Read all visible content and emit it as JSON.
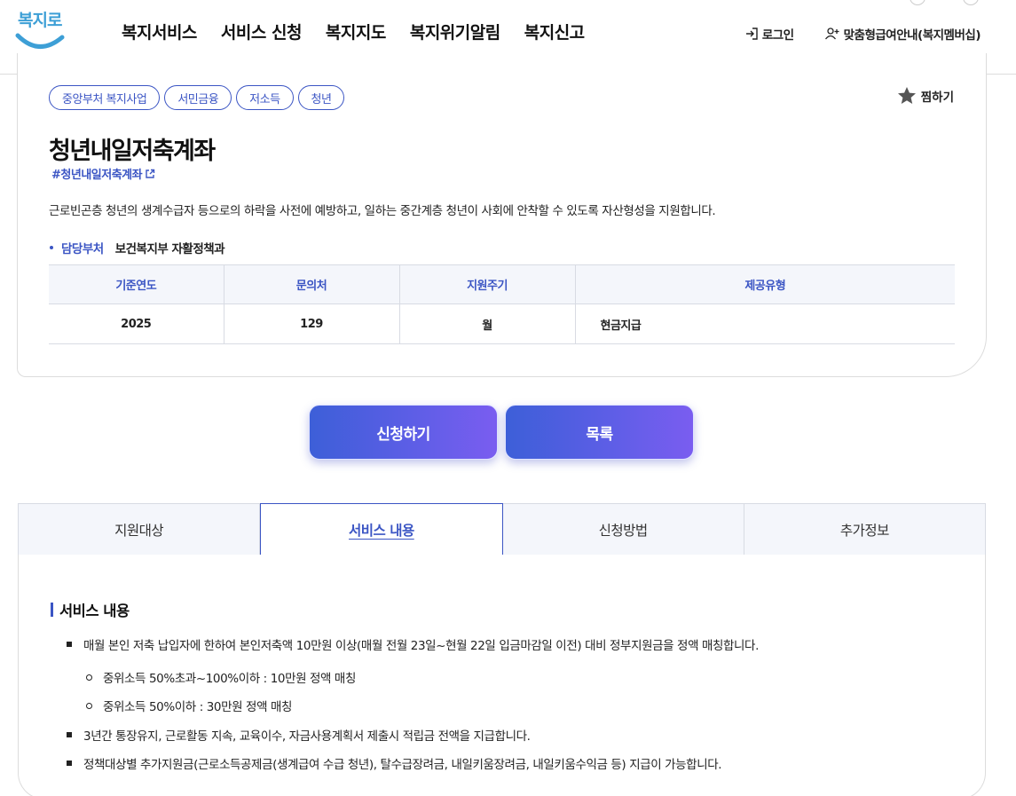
{
  "header": {
    "logo_text": "복지로",
    "nav": [
      "복지서비스",
      "서비스 신청",
      "복지지도",
      "복지위기알림",
      "복지신고"
    ],
    "login": "로그인",
    "membership": "맞춤형급여안내(복지멤버십)"
  },
  "service": {
    "tags": [
      "중앙부처 복지사업",
      "서민금융",
      "저소득",
      "청년"
    ],
    "favorite": "찜하기",
    "title": "청년내일저축계좌",
    "hashtag": "#청년내일저축계좌",
    "description": "근로빈곤층 청년의 생계수급자 등으로의 하락을 사전에 예방하고, 일하는 중간계층 청년이 사회에 안착할 수 있도록 자산형성을 지원합니다.",
    "dept_label": "담당부처",
    "dept_value": "보건복지부 자활정책과",
    "table": {
      "headers": [
        "기준연도",
        "문의처",
        "지원주기",
        "제공유형"
      ],
      "values": [
        "2025",
        "129",
        "월",
        "현금지급"
      ]
    }
  },
  "actions": {
    "apply": "신청하기",
    "list": "목록"
  },
  "tabs": [
    "지원대상",
    "서비스 내용",
    "신청방법",
    "추가정보"
  ],
  "content": {
    "section_title": "서비스 내용",
    "items": [
      "매월 본인 저축 납입자에 한하여 본인저축액 10만원 이상(매월 전월 23일~현월 22일 입금마감일 이전) 대비 정부지원금을 정액 매칭합니다.",
      "중위소득 50%초과~100%이하 : 10만원 정액 매칭",
      "중위소득 50%이하 : 30만원 정액 매칭",
      "3년간 통장유지, 근로활동 지속, 교육이수, 자금사용계획서 제출시 적립금 전액을 지급합니다.",
      "정책대상별 추가지원금(근로소득공제금(생계급여 수급 청년), 탈수급장려금, 내일키움장려금, 내일키움수익금 등) 지급이 가능합니다."
    ]
  },
  "colors": {
    "primary": "#3b55c4",
    "button_gradient_start": "#3d5fd8",
    "button_gradient_end": "#7a5df0",
    "logo": "#3d9fd6"
  }
}
